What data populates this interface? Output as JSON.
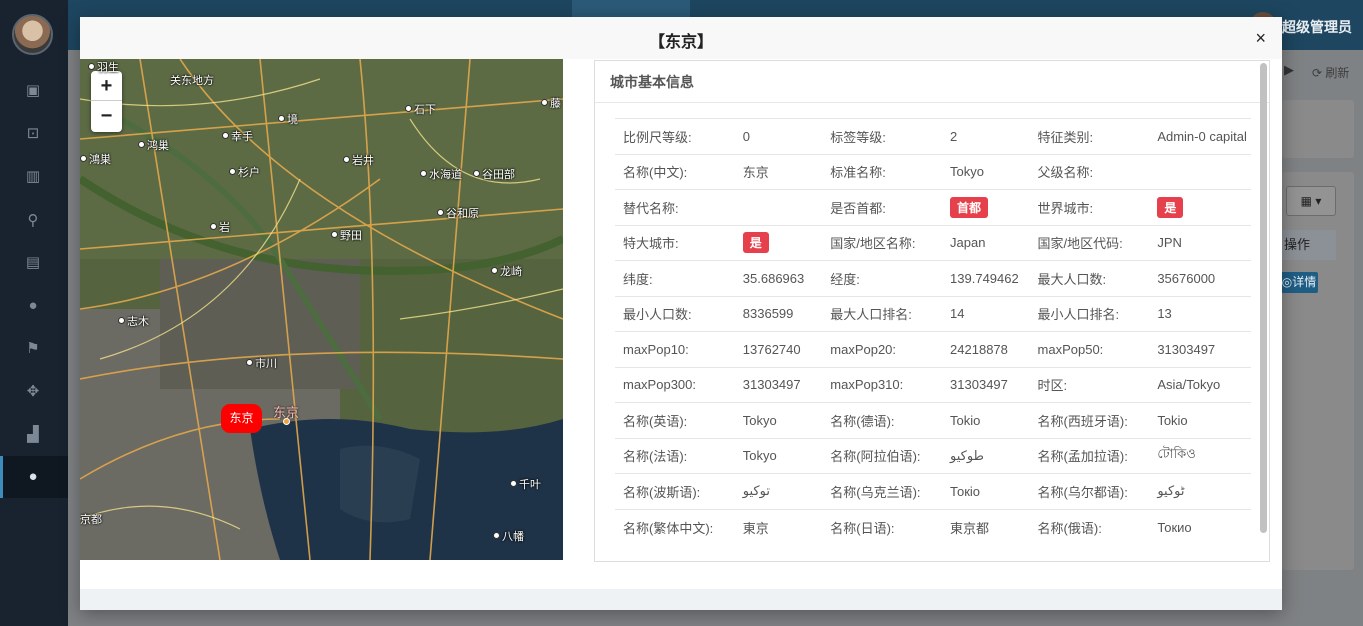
{
  "background": {
    "admin_name": "超级管理员",
    "refresh_label": "刷新",
    "table_column": "操作",
    "detail_button": "详情"
  },
  "modal": {
    "title": "【东京】",
    "close_label": "×"
  },
  "map": {
    "zoom_in": "+",
    "zoom_out": "−",
    "marker_label": "东京",
    "city_label": "东京",
    "place_labels": [
      "羽生",
      "关东地方",
      "鸿巢",
      "幸手",
      "境",
      "石下",
      "鴻巣",
      "岩井",
      "水海道",
      "谷田部",
      "杉户",
      "谷和原",
      "岩",
      "野田",
      "龙崎",
      "志木",
      "市川",
      "千叶",
      "八幡",
      "京都",
      "藤"
    ]
  },
  "info": {
    "title": "城市基本信息",
    "rows": [
      [
        {
          "label": "比例尺等级:",
          "value": "0"
        },
        {
          "label": "标签等级:",
          "value": "2"
        },
        {
          "label": "特征类别:",
          "value": "Admin-0 capital"
        }
      ],
      [
        {
          "label": "名称(中文):",
          "value": "东京"
        },
        {
          "label": "标准名称:",
          "value": "Tokyo"
        },
        {
          "label": "父级名称:",
          "value": ""
        }
      ],
      [
        {
          "label": "替代名称:",
          "value": ""
        },
        {
          "label": "是否首都:",
          "value": "首都",
          "badge": true
        },
        {
          "label": "世界城市:",
          "value": "是",
          "badge": true
        }
      ],
      [
        {
          "label": "特大城市:",
          "value": "是",
          "badge": true
        },
        {
          "label": "国家/地区名称:",
          "value": "Japan"
        },
        {
          "label": "国家/地区代码:",
          "value": "JPN"
        }
      ],
      [
        {
          "label": "纬度:",
          "value": "35.686963"
        },
        {
          "label": "经度:",
          "value": "139.749462"
        },
        {
          "label": "最大人口数:",
          "value": "35676000"
        }
      ],
      [
        {
          "label": "最小人口数:",
          "value": "8336599"
        },
        {
          "label": "最大人口排名:",
          "value": "14"
        },
        {
          "label": "最小人口排名:",
          "value": "13"
        }
      ],
      [
        {
          "label": "maxPop10:",
          "value": "13762740"
        },
        {
          "label": "maxPop20:",
          "value": "24218878"
        },
        {
          "label": "maxPop50:",
          "value": "31303497"
        }
      ],
      [
        {
          "label": "maxPop300:",
          "value": "31303497"
        },
        {
          "label": "maxPop310:",
          "value": "31303497"
        },
        {
          "label": "时区:",
          "value": "Asia/Tokyo"
        }
      ],
      [
        {
          "label": "名称(英语):",
          "value": "Tokyo"
        },
        {
          "label": "名称(德语):",
          "value": "Tokio"
        },
        {
          "label": "名称(西班牙语):",
          "value": "Tokio"
        }
      ],
      [
        {
          "label": "名称(法语):",
          "value": "Tokyo"
        },
        {
          "label": "名称(阿拉伯语):",
          "value": "طوكيو"
        },
        {
          "label": "名称(孟加拉语):",
          "value": "টোকিও"
        }
      ],
      [
        {
          "label": "名称(波斯语):",
          "value": "توکیو"
        },
        {
          "label": "名称(乌克兰语):",
          "value": "Токіо"
        },
        {
          "label": "名称(乌尔都语):",
          "value": "ٹوکیو"
        }
      ],
      [
        {
          "label": "名称(繁体中文):",
          "value": "東京"
        },
        {
          "label": "名称(日语):",
          "value": "東京都"
        },
        {
          "label": "名称(俄语):",
          "value": "Токио"
        }
      ]
    ]
  }
}
